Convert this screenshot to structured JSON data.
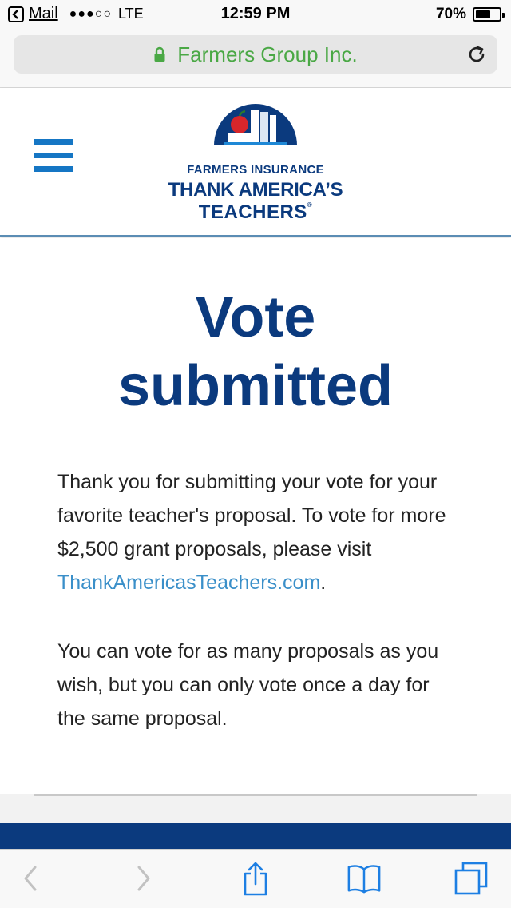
{
  "status_bar": {
    "back_app": "Mail",
    "signal": "●●●○○",
    "carrier": "LTE",
    "time": "12:59 PM",
    "battery_text": "70%",
    "battery_level": 0.7
  },
  "address_bar": {
    "site_name": "Farmers Group Inc.",
    "secure": true,
    "accent_color": "#4aa845"
  },
  "header": {
    "logo_line1": "FARMERS INSURANCE",
    "logo_line2": "THANK AMERICA’S",
    "logo_line3": "TEACHERS",
    "logo_mark": "®",
    "brand_color": "#0b3a7e",
    "menu_color": "#1576c4"
  },
  "main": {
    "heading_line1": "Vote",
    "heading_line2": "submitted",
    "para1_text": "Thank you for submitting your vote for your favorite teacher's proposal. To vote for more $2,500 grant proposals, please visit ",
    "para1_link": "ThankAmericasTeachers.com",
    "para1_end": ".",
    "para2_text": "You can vote for as many proposals as you wish, but you can only vote once a day for the same proposal.",
    "link_color": "#3a8fc9"
  },
  "toolbar": {
    "icons": [
      "back-icon",
      "forward-icon",
      "share-icon",
      "bookmarks-icon",
      "tabs-icon"
    ],
    "icon_color": "#1d7fe3",
    "disabled_color": "#c2c2c2"
  }
}
